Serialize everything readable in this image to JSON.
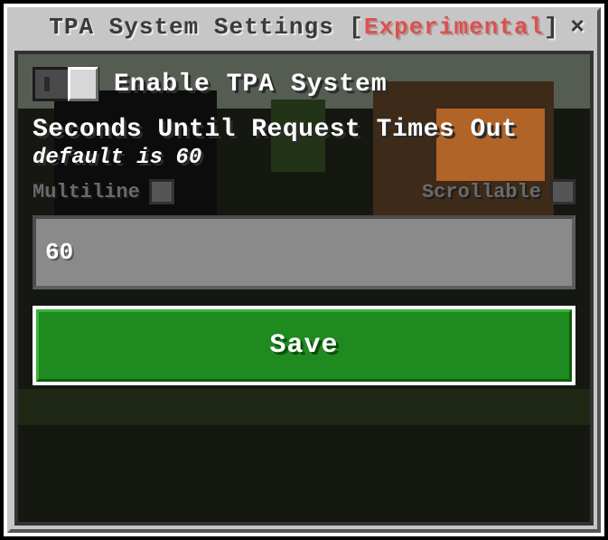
{
  "titlebar": {
    "prefix": "TPA System Settings ",
    "bracket_open": "[",
    "experimental": "Experimental",
    "bracket_close": "]",
    "close_glyph": "×"
  },
  "toggle": {
    "label": "Enable TPA System",
    "state": "on"
  },
  "timeout": {
    "label": "Seconds Until Request Times Out",
    "hint": "default is 60",
    "value": "60"
  },
  "options": {
    "multiline_label": "Multiline",
    "multiline_checked": false,
    "scrollable_label": "Scrollable",
    "scrollable_checked": false
  },
  "save": {
    "label": "Save"
  }
}
